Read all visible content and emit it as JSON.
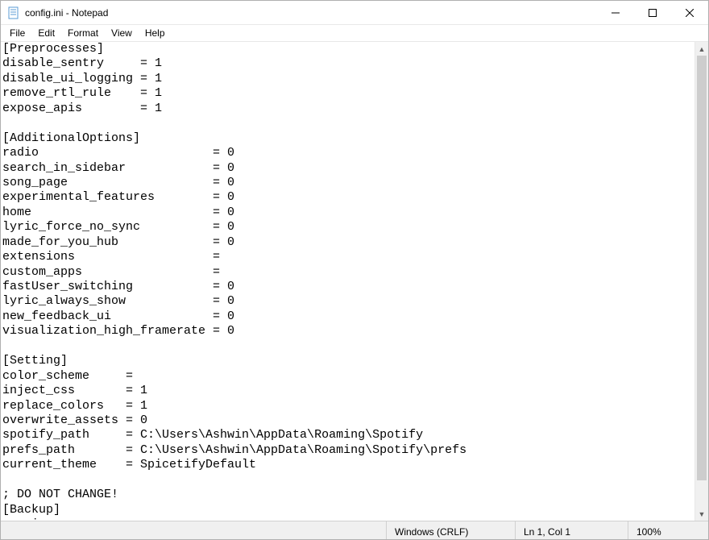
{
  "titlebar": {
    "title": "config.ini - Notepad"
  },
  "menu": {
    "items": [
      "File",
      "Edit",
      "Format",
      "View",
      "Help"
    ]
  },
  "editor": {
    "content": "[Preprocesses]\ndisable_sentry     = 1\ndisable_ui_logging = 1\nremove_rtl_rule    = 1\nexpose_apis        = 1\n\n[AdditionalOptions]\nradio                        = 0\nsearch_in_sidebar            = 0\nsong_page                    = 0\nexperimental_features        = 0\nhome                         = 0\nlyric_force_no_sync          = 0\nmade_for_you_hub             = 0\nextensions                   =\ncustom_apps                  =\nfastUser_switching           = 0\nlyric_always_show            = 0\nnew_feedback_ui              = 0\nvisualization_high_framerate = 0\n\n[Setting]\ncolor_scheme     =\ninject_css       = 1\nreplace_colors   = 1\noverwrite_assets = 0\nspotify_path     = C:\\Users\\Ashwin\\AppData\\Roaming\\Spotify\nprefs_path       = C:\\Users\\Ashwin\\AppData\\Roaming\\Spotify\\prefs\ncurrent_theme    = SpicetifyDefault\n\n; DO NOT CHANGE!\n[Backup]\nversion ="
  },
  "statusbar": {
    "encoding": "Windows (CRLF)",
    "position": "Ln 1, Col 1",
    "zoom": "100%"
  }
}
